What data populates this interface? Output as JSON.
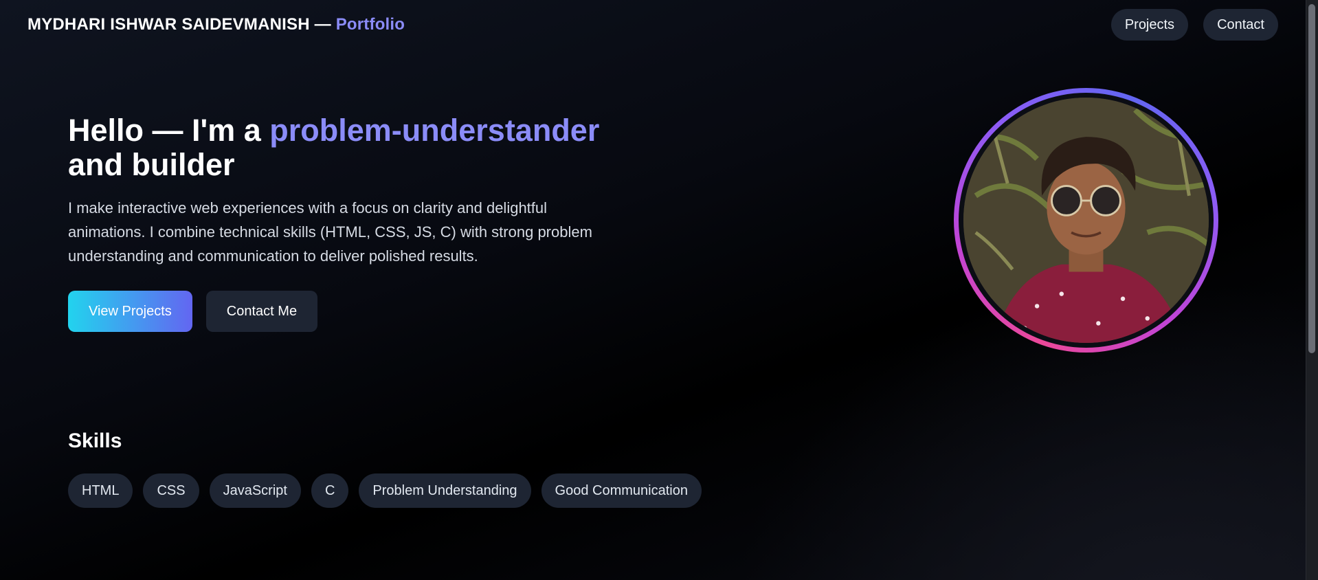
{
  "header": {
    "brand_name": "MYDHARI ISHWAR SAIDEVMANISH —",
    "brand_accent": "Portfolio",
    "nav": [
      {
        "label": "Projects"
      },
      {
        "label": "Contact"
      }
    ]
  },
  "hero": {
    "title_prefix": "Hello — I'm a ",
    "title_highlight": "problem-understander",
    "title_suffix": "and builder",
    "description": "I make interactive web experiences with a focus on clarity and delightful animations. I combine technical skills (HTML, CSS, JS, C) with strong problem understanding and communication to deliver polished results.",
    "primary_button": "View Projects",
    "secondary_button": "Contact Me"
  },
  "skills": {
    "title": "Skills",
    "items": [
      "HTML",
      "CSS",
      "JavaScript",
      "C",
      "Problem Understanding",
      "Good Communication"
    ]
  },
  "colors": {
    "accent": "#8b8cf8",
    "chip_bg": "#1e2533",
    "primary_gradient_start": "#22d3ee",
    "primary_gradient_end": "#6366f1",
    "ring_pink": "#ec4899",
    "ring_indigo": "#6366f1"
  }
}
